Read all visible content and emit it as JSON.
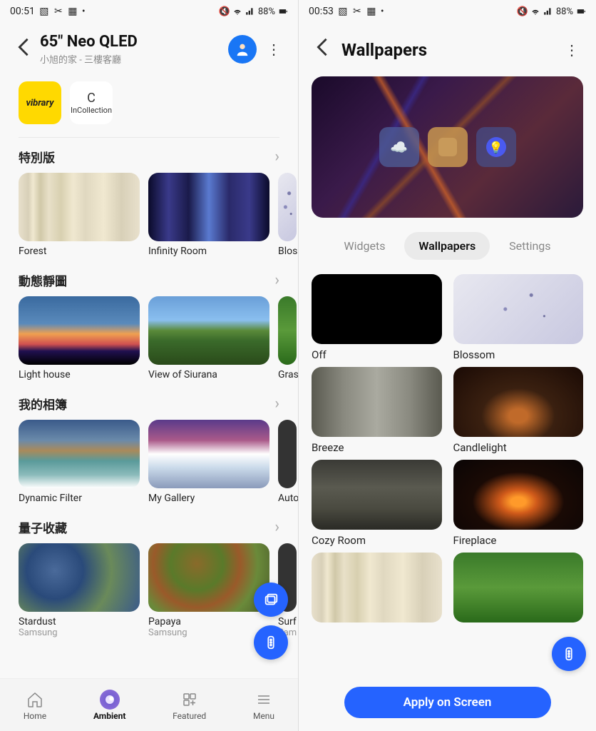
{
  "left": {
    "status": {
      "time": "00:51",
      "battery": "88%"
    },
    "header": {
      "title": "65\" Neo QLED",
      "subtitle": "小旭的家 - 三樓客廳"
    },
    "apps": {
      "vibrary": "vibrary",
      "incollection": "InCollection"
    },
    "sections": [
      {
        "title": "特別版",
        "items": [
          {
            "label": "Forest",
            "cls": "th-forest"
          },
          {
            "label": "Infinity Room",
            "cls": "th-infinity"
          },
          {
            "label": "Blos",
            "cls": "th-blossom",
            "peek": true
          }
        ]
      },
      {
        "title": "動態靜圖",
        "items": [
          {
            "label": "Light house",
            "cls": "th-lighthouse"
          },
          {
            "label": "View of Siurana",
            "cls": "th-siurana"
          },
          {
            "label": "Gras",
            "cls": "th-green",
            "peek": true
          }
        ]
      },
      {
        "title": "我的相簿",
        "items": [
          {
            "label": "Dynamic Filter",
            "cls": "th-dynamic"
          },
          {
            "label": "My Gallery",
            "cls": "th-gallery"
          },
          {
            "label": "Auto",
            "cls": "",
            "peek": true
          }
        ]
      },
      {
        "title": "量子收藏",
        "items": [
          {
            "label": "Stardust",
            "sublabel": "Samsung",
            "cls": "th-stardust"
          },
          {
            "label": "Papaya",
            "sublabel": "Samsung",
            "cls": "th-papaya"
          },
          {
            "label": "Surf",
            "sublabel": "Sam",
            "cls": "",
            "peek": true
          }
        ]
      }
    ],
    "nav": {
      "home": "Home",
      "ambient": "Ambient",
      "featured": "Featured",
      "menu": "Menu"
    }
  },
  "right": {
    "status": {
      "time": "00:53",
      "battery": "88%"
    },
    "header": {
      "title": "Wallpapers"
    },
    "tabs": {
      "widgets": "Widgets",
      "wallpapers": "Wallpapers",
      "settings": "Settings"
    },
    "wallpapers": [
      {
        "label": "Off",
        "cls": "th-off"
      },
      {
        "label": "Blossom",
        "cls": "th-blossom"
      },
      {
        "label": "Breeze",
        "cls": "th-breeze"
      },
      {
        "label": "Candlelight",
        "cls": "th-candle"
      },
      {
        "label": "Cozy Room",
        "cls": "th-cozy"
      },
      {
        "label": "Fireplace",
        "cls": "th-fireplace"
      },
      {
        "label": "",
        "cls": "th-forest"
      },
      {
        "label": "",
        "cls": "th-green"
      }
    ],
    "apply": "Apply on Screen"
  }
}
